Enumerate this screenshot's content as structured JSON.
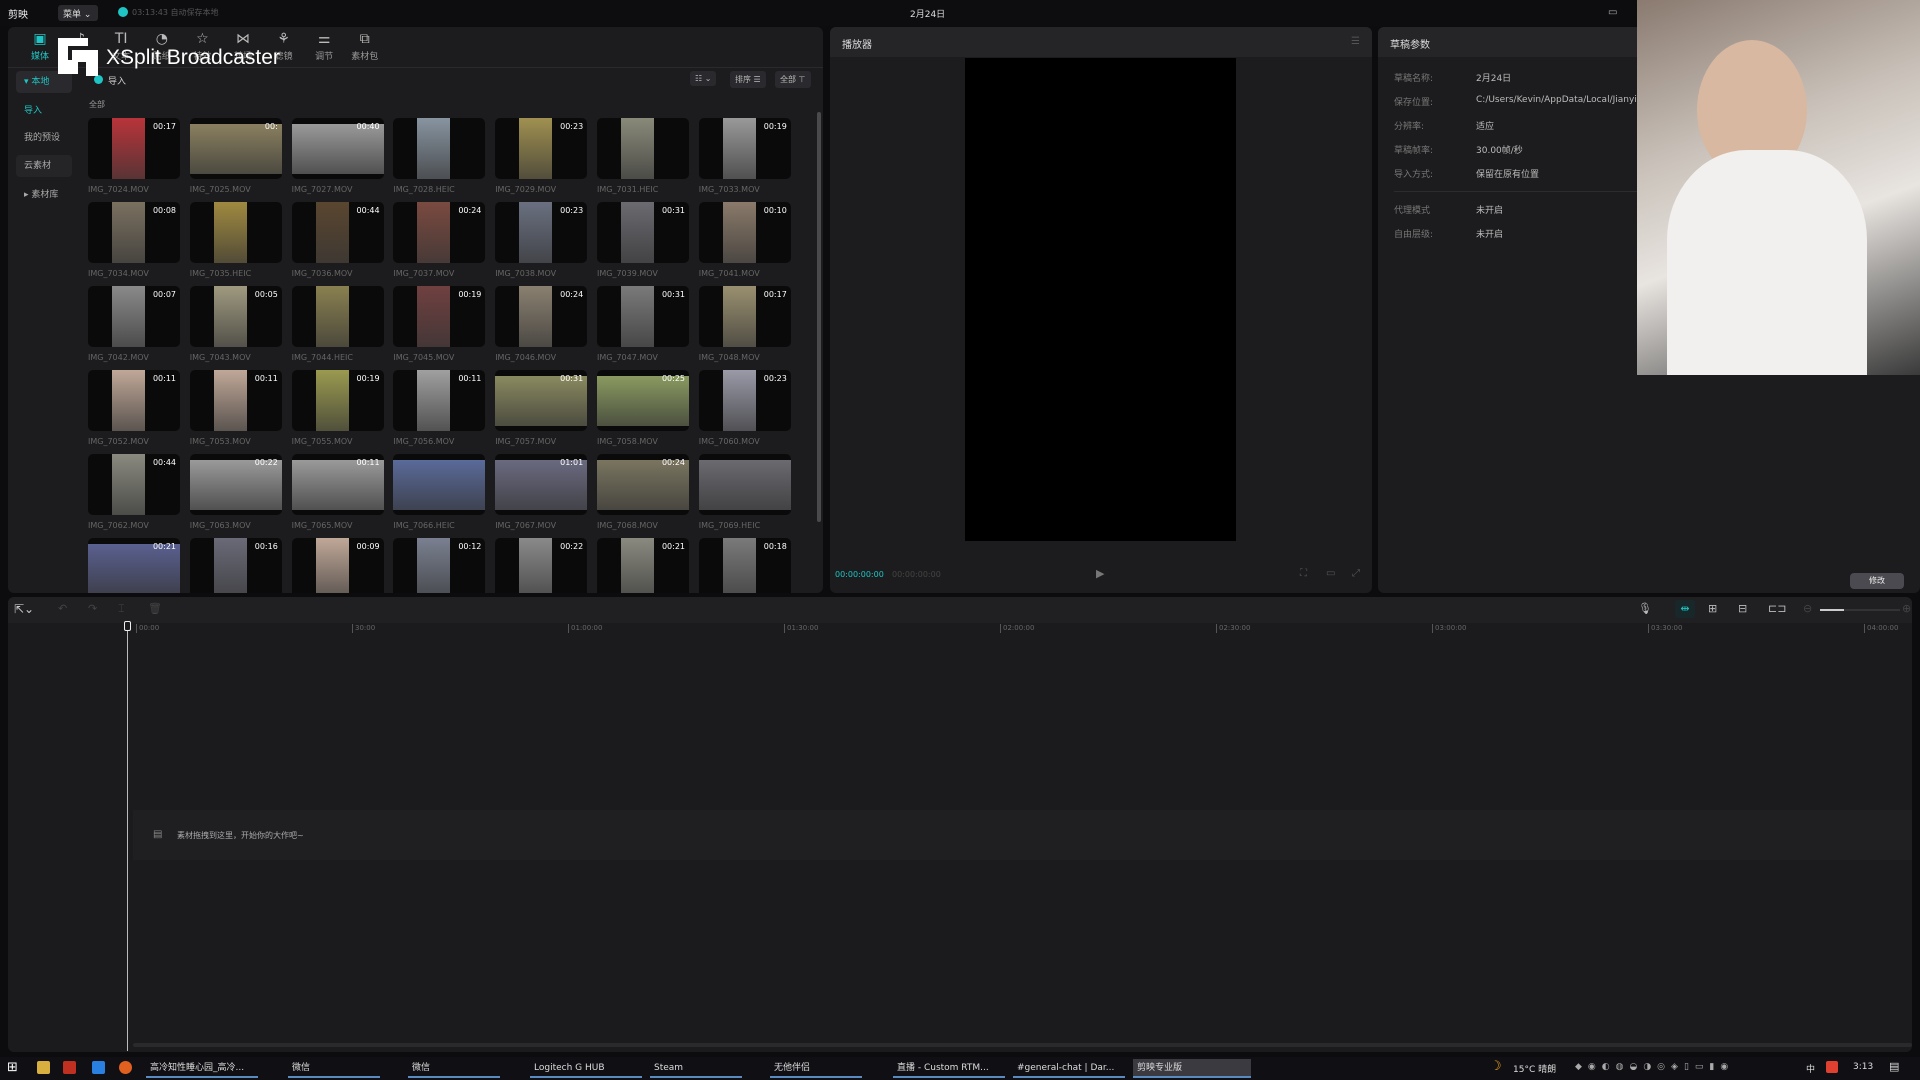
{
  "topbar": {
    "app_name": "剪映",
    "menu": "菜单",
    "autosave": "03:13:43 自动保存本地",
    "title": "2月24日"
  },
  "overlay": {
    "brand": "XSplit Broadcaster"
  },
  "toolbar": [
    {
      "label": "媒体",
      "icon": "media-icon",
      "g": "▣"
    },
    {
      "label": "音频",
      "icon": "audio-icon",
      "g": "♪"
    },
    {
      "label": "文本",
      "icon": "text-icon",
      "g": "TI"
    },
    {
      "label": "贴纸",
      "icon": "sticker-icon",
      "g": "◔"
    },
    {
      "label": "特效",
      "icon": "effects-icon",
      "g": "☆"
    },
    {
      "label": "转场",
      "icon": "transition-icon",
      "g": "⋈"
    },
    {
      "label": "滤镜",
      "icon": "filter-icon",
      "g": "⚘"
    },
    {
      "label": "调节",
      "icon": "adjust-icon",
      "g": "⚌"
    },
    {
      "label": "素材包",
      "icon": "package-icon",
      "g": "⧉"
    }
  ],
  "sidebar": [
    {
      "label": "▾ 本地"
    },
    {
      "label": "导入"
    },
    {
      "label": "我的预设"
    },
    {
      "label": "云素材"
    },
    {
      "label": "▸ 素材库"
    }
  ],
  "media": {
    "import_label": "导入",
    "section": "全部",
    "view_label": "☷ ⌄",
    "sort_label": "排序 ☰",
    "filter_label": "全部 ⊤",
    "items": [
      {
        "name": "IMG_7024.MOV",
        "duration": "00:17",
        "orientation": "portrait",
        "tone": "#b8343a"
      },
      {
        "name": "IMG_7025.MOV",
        "duration": "00:",
        "orientation": "landscape",
        "tone": "#8a8060"
      },
      {
        "name": "IMG_7027.MOV",
        "duration": "00:40",
        "orientation": "landscape",
        "tone": "#9a9a9a"
      },
      {
        "name": "IMG_7028.HEIC",
        "duration": "",
        "orientation": "portrait",
        "tone": "#8894a0"
      },
      {
        "name": "IMG_7029.MOV",
        "duration": "00:23",
        "orientation": "portrait",
        "tone": "#a09050"
      },
      {
        "name": "IMG_7031.HEIC",
        "duration": "",
        "orientation": "portrait",
        "tone": "#8a8a7a"
      },
      {
        "name": "IMG_7033.MOV",
        "duration": "00:19",
        "orientation": "portrait",
        "tone": "#999999"
      },
      {
        "name": "IMG_7034.MOV",
        "duration": "00:08",
        "orientation": "portrait",
        "tone": "#7a7060"
      },
      {
        "name": "IMG_7035.HEIC",
        "duration": "",
        "orientation": "portrait",
        "tone": "#a08a40"
      },
      {
        "name": "IMG_7036.MOV",
        "duration": "00:44",
        "orientation": "portrait",
        "tone": "#5a4630"
      },
      {
        "name": "IMG_7037.MOV",
        "duration": "00:24",
        "orientation": "portrait",
        "tone": "#7a4a40"
      },
      {
        "name": "IMG_7038.MOV",
        "duration": "00:23",
        "orientation": "portrait",
        "tone": "#6a7080"
      },
      {
        "name": "IMG_7039.MOV",
        "duration": "00:31",
        "orientation": "portrait",
        "tone": "#6a6a70"
      },
      {
        "name": "IMG_7041.MOV",
        "duration": "00:10",
        "orientation": "portrait",
        "tone": "#8a7a6a"
      },
      {
        "name": "IMG_7042.MOV",
        "duration": "00:07",
        "orientation": "portrait",
        "tone": "#8a8a8a"
      },
      {
        "name": "IMG_7043.MOV",
        "duration": "00:05",
        "orientation": "portrait",
        "tone": "#a09a80"
      },
      {
        "name": "IMG_7044.HEIC",
        "duration": "",
        "orientation": "portrait",
        "tone": "#8a8050"
      },
      {
        "name": "IMG_7045.MOV",
        "duration": "00:19",
        "orientation": "portrait",
        "tone": "#704040"
      },
      {
        "name": "IMG_7046.MOV",
        "duration": "00:24",
        "orientation": "portrait",
        "tone": "#8a8070"
      },
      {
        "name": "IMG_7047.MOV",
        "duration": "00:31",
        "orientation": "portrait",
        "tone": "#7a7a7a"
      },
      {
        "name": "IMG_7048.MOV",
        "duration": "00:17",
        "orientation": "portrait",
        "tone": "#9a9070"
      },
      {
        "name": "IMG_7052.MOV",
        "duration": "00:11",
        "orientation": "portrait",
        "tone": "#c0a898"
      },
      {
        "name": "IMG_7053.MOV",
        "duration": "00:11",
        "orientation": "portrait",
        "tone": "#c0a898"
      },
      {
        "name": "IMG_7055.MOV",
        "duration": "00:19",
        "orientation": "portrait",
        "tone": "#9a9a50"
      },
      {
        "name": "IMG_7056.MOV",
        "duration": "00:11",
        "orientation": "portrait",
        "tone": "#a0a0a0"
      },
      {
        "name": "IMG_7057.MOV",
        "duration": "00:31",
        "orientation": "landscape",
        "tone": "#8a8a60"
      },
      {
        "name": "IMG_7058.MOV",
        "duration": "00:25",
        "orientation": "landscape",
        "tone": "#8a9a60"
      },
      {
        "name": "IMG_7060.MOV",
        "duration": "00:23",
        "orientation": "portrait",
        "tone": "#9a9aa8"
      },
      {
        "name": "IMG_7062.MOV",
        "duration": "00:44",
        "orientation": "portrait",
        "tone": "#8a8a80"
      },
      {
        "name": "IMG_7063.MOV",
        "duration": "00:22",
        "orientation": "landscape",
        "tone": "#9a9a9a"
      },
      {
        "name": "IMG_7065.MOV",
        "duration": "00:11",
        "orientation": "landscape",
        "tone": "#9a9a9a"
      },
      {
        "name": "IMG_7066.HEIC",
        "duration": "",
        "orientation": "landscape",
        "tone": "#5a6a9a"
      },
      {
        "name": "IMG_7067.MOV",
        "duration": "01:01",
        "orientation": "landscape",
        "tone": "#6a6a80"
      },
      {
        "name": "IMG_7068.MOV",
        "duration": "00:24",
        "orientation": "landscape",
        "tone": "#7a7560"
      },
      {
        "name": "IMG_7069.HEIC",
        "duration": "",
        "orientation": "landscape",
        "tone": "#6a6a70"
      },
      {
        "name": "",
        "duration": "00:21",
        "orientation": "landscape",
        "tone": "#5a6090"
      },
      {
        "name": "",
        "duration": "00:16",
        "orientation": "portrait",
        "tone": "#6a6a78"
      },
      {
        "name": "",
        "duration": "00:09",
        "orientation": "portrait",
        "tone": "#c0a898"
      },
      {
        "name": "",
        "duration": "00:12",
        "orientation": "portrait",
        "tone": "#7a8090"
      },
      {
        "name": "",
        "duration": "00:22",
        "orientation": "portrait",
        "tone": "#8a8a8a"
      },
      {
        "name": "",
        "duration": "00:21",
        "orientation": "portrait",
        "tone": "#8a8a80"
      },
      {
        "name": "",
        "duration": "00:18",
        "orientation": "portrait",
        "tone": "#7a7a7a"
      }
    ]
  },
  "player": {
    "title": "播放器",
    "time_current": "00:00:00:00",
    "time_total": "00:00:00:00"
  },
  "params": {
    "title": "草稿参数",
    "rows": [
      {
        "label": "草稿名称:",
        "value": "2月24日"
      },
      {
        "label": "保存位置:",
        "value": "C:/Users/Kevin/AppData/Local/JianyingPro"
      },
      {
        "label": "分辨率:",
        "value": "适应"
      },
      {
        "label": "草稿帧率:",
        "value": "30.00帧/秒"
      },
      {
        "label": "导入方式:",
        "value": "保留在原有位置"
      },
      {
        "label": "代理模式",
        "value": "未开启"
      },
      {
        "label": "自由层级:",
        "value": "未开启"
      }
    ],
    "modify_label": "修改"
  },
  "timeline": {
    "ticks": [
      "00:00",
      "30:00",
      "01:00:00",
      "01:30:00",
      "02:00:00",
      "02:30:00",
      "03:00:00",
      "03:30:00",
      "04:00:00"
    ],
    "hint": "素材拖拽到这里，开始你的大作吧~",
    "zoom_level": 0.3
  },
  "taskbar": {
    "items": [
      "高冷知性睡心园_高冷...",
      "微信",
      "微信",
      "Logitech G HUB",
      "Steam",
      "无他伴侣",
      "直播 - Custom RTM...",
      "#general-chat | Dar...",
      "剪映专业版"
    ],
    "weather": "15°C 晴朗",
    "ime": "中",
    "clock": "3:13"
  },
  "colors": {
    "accent": "#1fc4c4",
    "panel": "#1c1c1e",
    "background": "#0c0c0e"
  }
}
